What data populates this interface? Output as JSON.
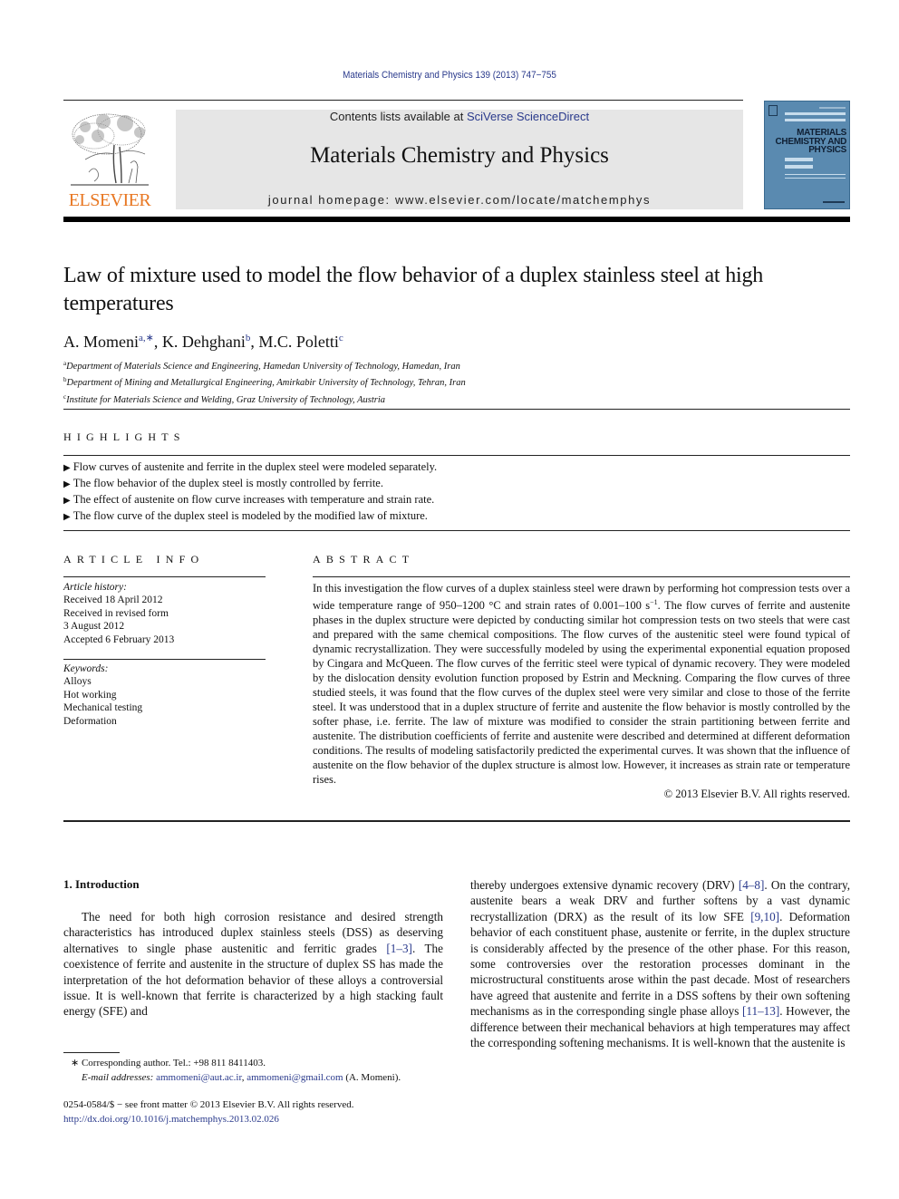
{
  "header": {
    "journal_ref": "Materials Chemistry and Physics 139 (2013) 747−755",
    "contents_prefix": "Contents lists available at ",
    "contents_link": "SciVerse ScienceDirect",
    "journal_title": "Materials Chemistry and Physics",
    "homepage": "journal homepage: www.elsevier.com/locate/matchemphys",
    "publisher_logo": "ELSEVIER",
    "cover_title_lines": [
      "MATERIALS",
      "CHEMISTRY AND",
      "PHYSICS"
    ]
  },
  "colors": {
    "link": "#2a3a8c",
    "elsevier_orange": "#e87722",
    "banner_gray": "#e6e6e6",
    "cover_blue": "#5a8ab0"
  },
  "article": {
    "title": "Law of mixture used to model the flow behavior of a duplex stainless steel at high temperatures",
    "authors": [
      {
        "name": "A. Momeni",
        "sup": "a,∗",
        "sep": ", "
      },
      {
        "name": "K. Dehghani",
        "sup": "b",
        "sep": ", "
      },
      {
        "name": "M.C. Poletti",
        "sup": "c",
        "sep": ""
      }
    ],
    "affiliations": [
      {
        "mark": "a",
        "text": "Department of Materials Science and Engineering, Hamedan University of Technology, Hamedan, Iran"
      },
      {
        "mark": "b",
        "text": "Department of Mining and Metallurgical Engineering, Amirkabir University of Technology, Tehran, Iran"
      },
      {
        "mark": "c",
        "text": "Institute for Materials Science and Welding, Graz University of Technology, Austria"
      }
    ]
  },
  "highlights": {
    "heading": "HIGHLIGHTS",
    "bullet": "▶",
    "items": [
      "Flow curves of austenite and ferrite in the duplex steel were modeled separately.",
      "The flow behavior of the duplex steel is mostly controlled by ferrite.",
      "The effect of austenite on flow curve increases with temperature and strain rate.",
      "The flow curve of the duplex steel is modeled by the modified law of mixture."
    ]
  },
  "article_info": {
    "heading": "ARTICLE INFO",
    "history_label": "Article history:",
    "history": [
      "Received 18 April 2012",
      "Received in revised form",
      "3 August 2012",
      "Accepted 6 February 2013"
    ],
    "keywords_label": "Keywords:",
    "keywords": [
      "Alloys",
      "Hot working",
      "Mechanical testing",
      "Deformation"
    ]
  },
  "abstract": {
    "heading": "ABSTRACT",
    "text_part1": "In this investigation the flow curves of a duplex stainless steel were drawn by performing hot compression tests over a wide temperature range of 950–1200 °C and strain rates of 0.001–100 s",
    "text_sup": "−1",
    "text_part2": ". The flow curves of ferrite and austenite phases in the duplex structure were depicted by conducting similar hot compression tests on two steels that were cast and prepared with the same chemical compositions. The flow curves of the austenitic steel were found typical of dynamic recrystallization. They were successfully modeled by using the experimental exponential equation proposed by Cingara and McQueen. The flow curves of the ferritic steel were typical of dynamic recovery. They were modeled by the dislocation density evolution function proposed by Estrin and Meckning. Comparing the flow curves of three studied steels, it was found that the flow curves of the duplex steel were very similar and close to those of the ferrite steel. It was understood that in a duplex structure of ferrite and austenite the flow behavior is mostly controlled by the softer phase, i.e. ferrite. The law of mixture was modified to consider the strain partitioning between ferrite and austenite. The distribution coefficients of ferrite and austenite were described and determined at different deformation conditions. The results of modeling satisfactorily predicted the experimental curves. It was shown that the influence of austenite on the flow behavior of the duplex structure is almost low. However, it increases as strain rate or temperature rises.",
    "copyright": "© 2013 Elsevier B.V. All rights reserved."
  },
  "body": {
    "section_heading": "1.  Introduction",
    "left": {
      "p1": "The need for both high corrosion resistance and desired strength characteristics has introduced duplex stainless steels (DSS) as deserving alternatives to single phase austenitic and ferritic grades ",
      "ref1": "[1–3]",
      "p2": ". The coexistence of ferrite and austenite in the structure of duplex SS has made the interpretation of the hot deformation behavior of these alloys a controversial issue. It is well-known that ferrite is characterized by a high stacking fault energy (SFE) and"
    },
    "right": {
      "p1": "thereby undergoes extensive dynamic recovery (DRV) ",
      "ref1": "[4–8]",
      "p2": ". On the contrary, austenite bears a weak DRV and further softens by a vast dynamic recrystallization (DRX) as the result of its low SFE ",
      "ref2": "[9,10]",
      "p3": ". Deformation behavior of each constituent phase, austenite or ferrite, in the duplex structure is considerably affected by the presence of the other phase. For this reason, some controversies over the restoration processes dominant in the microstructural constituents arose within the past decade. Most of researchers have agreed that austenite and ferrite in a DSS softens by their own softening mechanisms as in the corresponding single phase alloys ",
      "ref3": "[11–13]",
      "p4": ". However, the difference between their mechanical behaviors at high temperatures may affect the corresponding softening mechanisms. It is well-known that the austenite is"
    }
  },
  "footnotes": {
    "corresponding": "∗  Corresponding author. Tel.: +98 811 8411403.",
    "email_label": "E-mail addresses: ",
    "email1": "ammomeni@aut.ac.ir",
    "email_sep": ", ",
    "email2": "ammomeni@gmail.com",
    "email_suffix": " (A. Momeni).",
    "front_matter": "0254-0584/$ − see front matter © 2013 Elsevier B.V. All rights reserved.",
    "doi": "http://dx.doi.org/10.1016/j.matchemphys.2013.02.026"
  }
}
